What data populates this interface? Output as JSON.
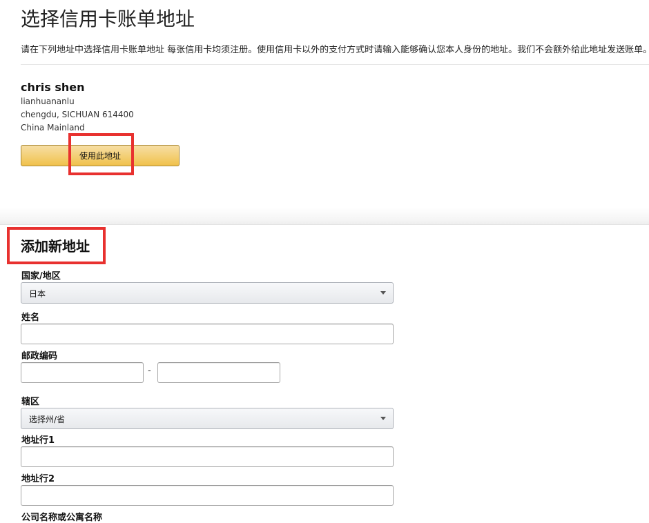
{
  "page": {
    "title": "选择信用卡账单地址",
    "intro": "请在下列地址中选择信用卡账单地址 每张信用卡均须注册。使用信用卡以外的支付方式时请输入能够确认您本人身份的地址。我们不会额外给此地址发送账单。"
  },
  "saved_address": {
    "name": "chris shen",
    "line1": "lianhuananlu",
    "line2": "chengdu, SICHUAN 614400",
    "line3": "China Mainland",
    "use_button": "使用此地址"
  },
  "new_address": {
    "title": "添加新地址",
    "country_label": "国家/地区",
    "country_value": "日本",
    "name_label": "姓名",
    "postal_label": "邮政编码",
    "postal_separator": "-",
    "prefecture_label": "辖区",
    "prefecture_value": "选择州/省",
    "line1_label": "地址行1",
    "line2_label": "地址行2",
    "company_label": "公司名称或公寓名称"
  },
  "highlight_color": "#e8312f",
  "button_color": "#f0c14b"
}
